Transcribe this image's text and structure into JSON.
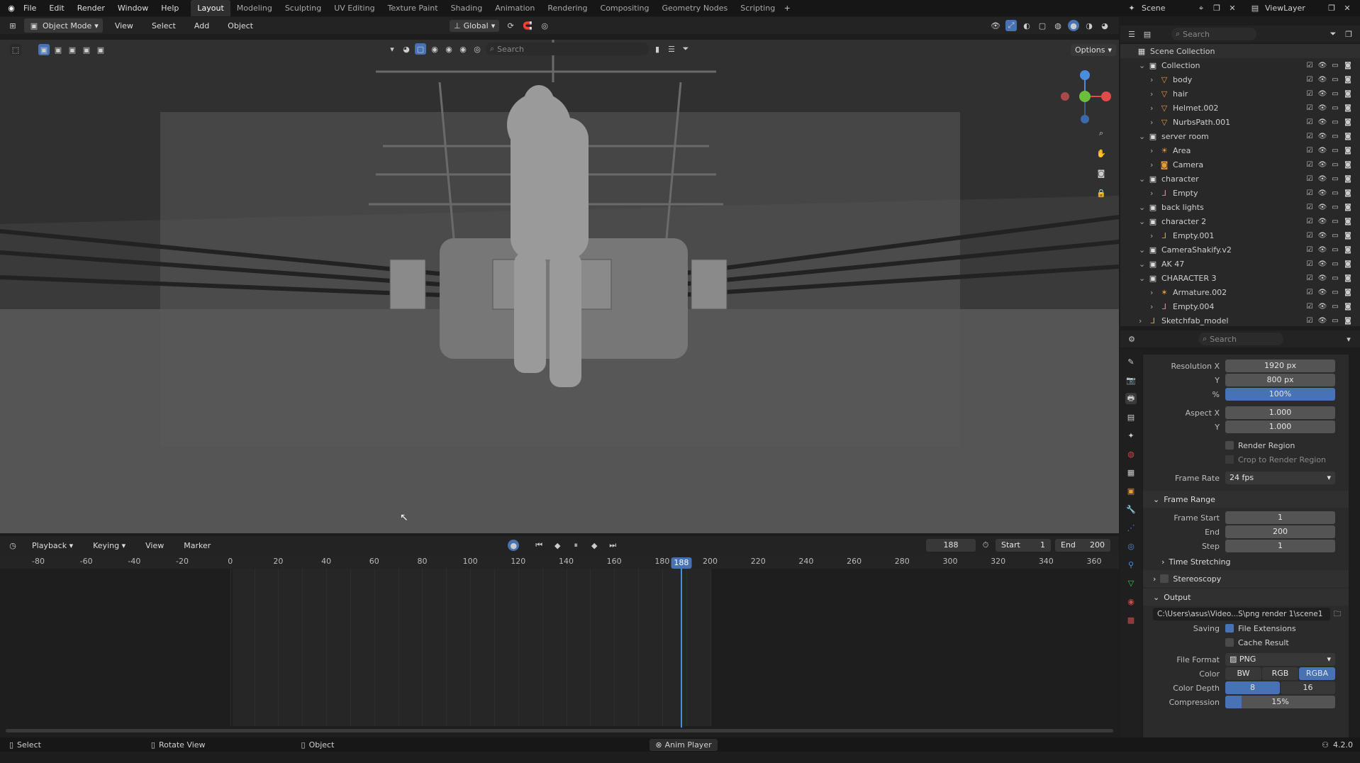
{
  "menubar": {
    "file": "File",
    "edit": "Edit",
    "render": "Render",
    "window": "Window",
    "help": "Help",
    "workspaces": [
      "Layout",
      "Modeling",
      "Sculpting",
      "UV Editing",
      "Texture Paint",
      "Shading",
      "Animation",
      "Rendering",
      "Compositing",
      "Geometry Nodes",
      "Scripting"
    ],
    "active_workspace": "Layout",
    "scene": "Scene",
    "viewlayer": "ViewLayer"
  },
  "viewport_header": {
    "mode": "Object Mode",
    "view": "View",
    "select": "Select",
    "add": "Add",
    "object": "Object",
    "orientation": "Global",
    "search_placeholder": "Search",
    "options": "Options"
  },
  "outliner": {
    "search_placeholder": "Search",
    "rows": [
      {
        "label": "Scene Collection",
        "indent": 0,
        "type": "scene"
      },
      {
        "label": "Collection",
        "indent": 1,
        "type": "coll"
      },
      {
        "label": "body",
        "indent": 2,
        "type": "mesh"
      },
      {
        "label": "hair",
        "indent": 2,
        "type": "mesh"
      },
      {
        "label": "Helmet.002",
        "indent": 2,
        "type": "mesh"
      },
      {
        "label": "NurbsPath.001",
        "indent": 2,
        "type": "mesh"
      },
      {
        "label": "server room",
        "indent": 1,
        "type": "coll"
      },
      {
        "label": "Area",
        "indent": 2,
        "type": "light"
      },
      {
        "label": "Camera",
        "indent": 2,
        "type": "camera"
      },
      {
        "label": "character",
        "indent": 1,
        "type": "coll"
      },
      {
        "label": "Empty",
        "indent": 2,
        "type": "empty"
      },
      {
        "label": "back lights",
        "indent": 1,
        "type": "coll"
      },
      {
        "label": "character 2",
        "indent": 1,
        "type": "coll"
      },
      {
        "label": "Empty.001",
        "indent": 2,
        "type": "empty"
      },
      {
        "label": "CameraShakify.v2",
        "indent": 1,
        "type": "coll"
      },
      {
        "label": "AK 47",
        "indent": 1,
        "type": "coll"
      },
      {
        "label": "CHARACTER 3",
        "indent": 1,
        "type": "coll"
      },
      {
        "label": "Armature.002",
        "indent": 2,
        "type": "armature"
      },
      {
        "label": "Empty.004",
        "indent": 2,
        "type": "empty"
      },
      {
        "label": "Sketchfab_model",
        "indent": 1,
        "type": "empty"
      }
    ]
  },
  "properties": {
    "search_placeholder": "Search",
    "resolution_x_label": "Resolution X",
    "resolution_x": "1920 px",
    "y_label": "Y",
    "resolution_y": "800 px",
    "pct_label": "%",
    "resolution_pct": "100%",
    "aspect_x_label": "Aspect X",
    "aspect_x": "1.000",
    "aspect_y": "1.000",
    "render_region": "Render Region",
    "crop_region": "Crop to Render Region",
    "frame_rate_label": "Frame Rate",
    "frame_rate": "24 fps",
    "frame_range": "Frame Range",
    "frame_start_label": "Frame Start",
    "frame_start": "1",
    "end_label": "End",
    "frame_end": "200",
    "step_label": "Step",
    "frame_step": "1",
    "time_stretching": "Time Stretching",
    "stereoscopy": "Stereoscopy",
    "output": "Output",
    "output_path": "C:\\Users\\asus\\Video...S\\png render 1\\scene1",
    "saving_label": "Saving",
    "file_extensions": "File Extensions",
    "cache_result": "Cache Result",
    "file_format_label": "File Format",
    "file_format": "PNG",
    "color_label": "Color",
    "color_bw": "BW",
    "color_rgb": "RGB",
    "color_rgba": "RGBA",
    "color_depth_label": "Color Depth",
    "depth_8": "8",
    "depth_16": "16",
    "compression_label": "Compression",
    "compression": "15%"
  },
  "timeline": {
    "playback": "Playback",
    "keying": "Keying",
    "view": "View",
    "marker": "Marker",
    "current_frame": "188",
    "start_label": "Start",
    "start": "1",
    "end_label": "End",
    "end": "200",
    "ticks": [
      "-80",
      "-60",
      "-40",
      "-20",
      "0",
      "20",
      "40",
      "60",
      "80",
      "100",
      "120",
      "140",
      "160",
      "180",
      "200",
      "220",
      "240",
      "260",
      "280",
      "300",
      "320",
      "340",
      "360"
    ],
    "playhead": "188"
  },
  "statusbar": {
    "select": "Select",
    "rotate": "Rotate View",
    "object": "Object",
    "anim_player": "Anim Player",
    "version": "4.2.0"
  }
}
